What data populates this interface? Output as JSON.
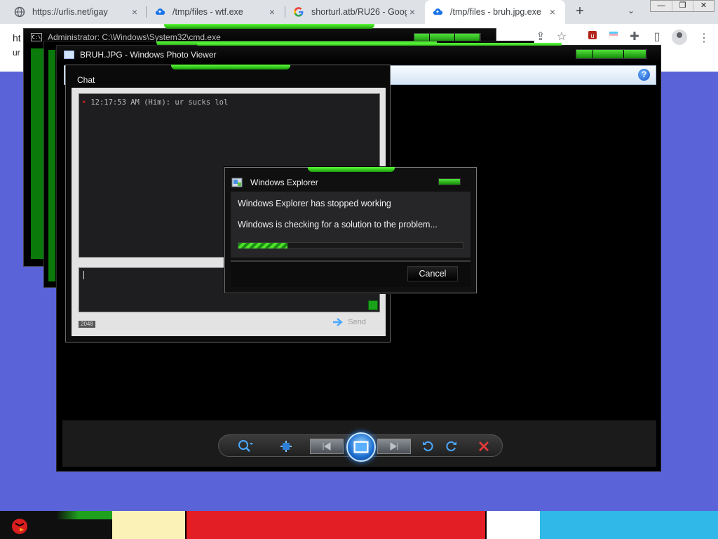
{
  "browser": {
    "tabs": [
      {
        "title": "https://urlis.net/igay",
        "active": false,
        "favicon": "globe-icon"
      },
      {
        "title": "/tmp/files - wtf.exe",
        "active": false,
        "favicon": "cloud-upload-icon"
      },
      {
        "title": "shorturl.atb/RU26 - Goog",
        "active": false,
        "favicon": "google-icon"
      },
      {
        "title": "/tmp/files - bruh.jpg.exe",
        "active": true,
        "favicon": "cloud-upload-icon"
      }
    ],
    "tab_close_glyph": "×",
    "new_tab_glyph": "+",
    "tab_menu_glyph": "⌄",
    "window_controls": [
      "—",
      "❐",
      "✕"
    ],
    "page_fragment_top": "ht",
    "page_fragment_bottom": "ur",
    "accent_color": "#1a73e8"
  },
  "cmd_window": {
    "title": "Administrator: C:\\Windows\\System32\\cmd.exe",
    "icon_label": "C:\\"
  },
  "photo_viewer": {
    "title": "BRUH.JPG - Windows Photo Viewer",
    "help_label": "?",
    "controls": [
      "zoom-icon",
      "fit-icon",
      "previous-icon",
      "slideshow-icon",
      "next-icon",
      "rotate-left-icon",
      "rotate-right-icon",
      "delete-icon"
    ]
  },
  "chat": {
    "title": "Chat",
    "messages": [
      {
        "time": "12:17:53 AM",
        "author": "(Him)",
        "text": "ur sucks lol",
        "line": "12:17:53 AM (Him): ur sucks lol"
      }
    ],
    "char_count": "2048",
    "send_label": "Send"
  },
  "error_dialog": {
    "title": "Windows Explorer",
    "line1": "Windows Explorer has stopped working",
    "line2": "Windows is checking for a solution to the problem...",
    "progress": 0.22,
    "cancel_label": "Cancel"
  },
  "theme": {
    "desktop_bg": "#5b63d9",
    "window_accent_green": "#3ddc1e"
  }
}
